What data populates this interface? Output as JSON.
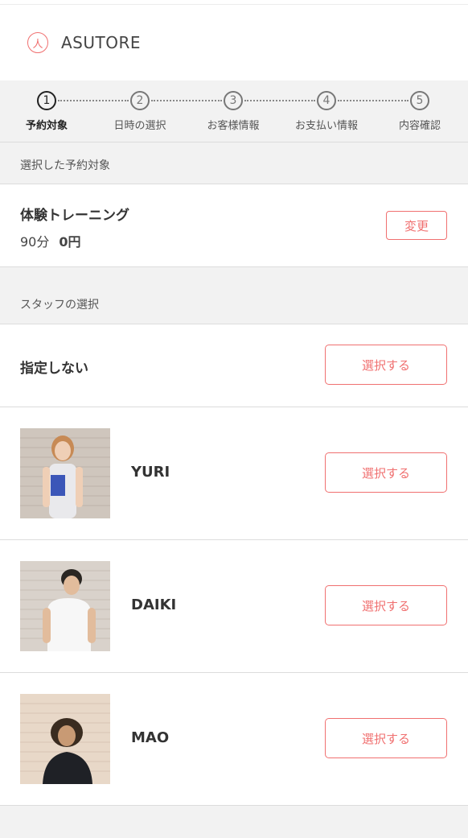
{
  "brand": {
    "name": "ASUTORE",
    "logo_glyph": "人"
  },
  "steps": [
    {
      "num": "1",
      "label": "予約対象",
      "active": true
    },
    {
      "num": "2",
      "label": "日時の選択",
      "active": false
    },
    {
      "num": "3",
      "label": "お客様情報",
      "active": false
    },
    {
      "num": "4",
      "label": "お支払い情報",
      "active": false
    },
    {
      "num": "5",
      "label": "内容確認",
      "active": false
    }
  ],
  "selected_target": {
    "heading": "選択した予約対象",
    "course_name": "体験トレーニング",
    "duration": "90分",
    "price": "0円",
    "change_label": "変更"
  },
  "staff_section": {
    "heading": "スタッフの選択",
    "no_preference_label": "指定しない",
    "select_label": "選択する",
    "staff": [
      {
        "name": "YURI"
      },
      {
        "name": "DAIKI"
      },
      {
        "name": "MAO"
      }
    ]
  },
  "colors": {
    "accent": "#f07070",
    "section_bg": "#f2f2f2"
  }
}
